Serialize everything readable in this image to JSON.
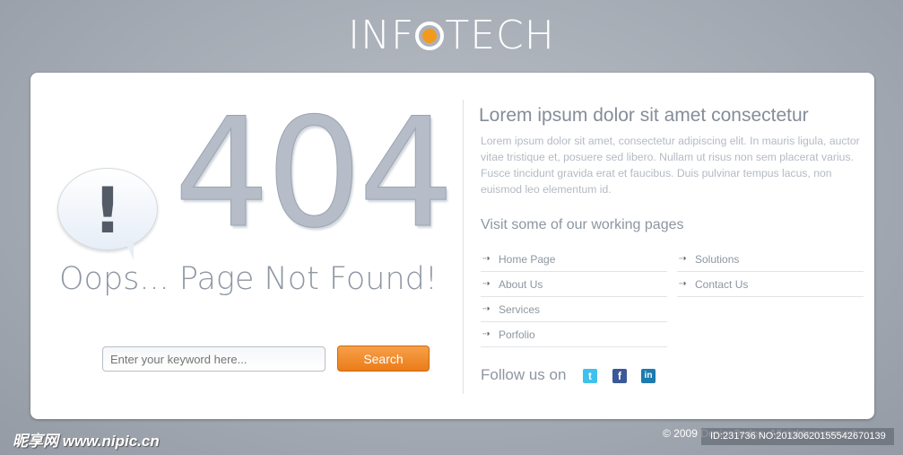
{
  "logo": {
    "before": "INF",
    "after": "TECH",
    "accent": "#f39a1c"
  },
  "error": {
    "code": "404",
    "icon": "exclamation-bubble-icon",
    "exclamation": "!",
    "message": "Oops... Page Not Found!"
  },
  "search": {
    "placeholder": "Enter your keyword here...",
    "button": "Search"
  },
  "info": {
    "title": "Lorem ipsum dolor sit amet consectetur",
    "body": "Lorem ipsum dolor sit amet, consectetur adipiscing elit. In mauris ligula, auctor vitae tristique et, posuere sed libero. Nullam ut risus non sem placerat varius. Fusce tincidunt gravida erat et faucibus. Duis pulvinar tempus lacus, non euismod leo elementum id."
  },
  "pages": {
    "title": "Visit some of our working pages",
    "col1": [
      {
        "label": "Home Page"
      },
      {
        "label": "About Us"
      },
      {
        "label": "Services"
      },
      {
        "label": "Porfolio"
      }
    ],
    "col2": [
      {
        "label": "Solutions"
      },
      {
        "label": "Contact Us"
      }
    ],
    "arrow": "⇢"
  },
  "social": {
    "label": "Follow us on",
    "items": [
      {
        "name": "twitter",
        "glyph": "t",
        "color": "#3fc1ee"
      },
      {
        "name": "facebook",
        "glyph": "f",
        "color": "#3b5998"
      },
      {
        "name": "linkedin",
        "glyph": "in",
        "color": "#1d7bb0"
      }
    ]
  },
  "footer": {
    "copyright": "© 2009 Design3edge. All rights reserved"
  },
  "watermark": {
    "site": "昵享网 www.nipic.cn",
    "id": "ID:231736 NO:20130620155542670139"
  }
}
